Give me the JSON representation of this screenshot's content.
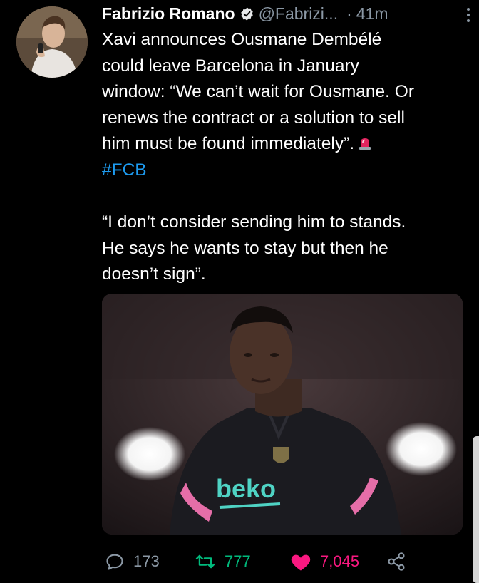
{
  "tweet": {
    "display_name": "Fabrizio Romano",
    "handle": "@Fabrizi...",
    "separator": "·",
    "time": "41m",
    "text_lines": [
      "Xavi announces Ousmane Dembélé",
      "could leave Barcelona in January",
      "window: “We can’t wait for Ousmane. Or",
      "renews the contract or a solution to sell",
      "him must be found immediately”."
    ],
    "hashtag": "#FCB",
    "quote_lines": [
      "“I don’t consider sending him to stands.",
      "He says he wants to stay but then he",
      "doesn’t sign”."
    ],
    "media_caption_logo": "beko",
    "stats": {
      "replies": "173",
      "retweets": "777",
      "likes": "7,045"
    }
  },
  "icons": {
    "verified": "verified-badge-icon",
    "more": "more-vertical-icon",
    "siren": "police-light-icon",
    "reply": "reply-icon",
    "retweet": "retweet-icon",
    "like": "heart-icon",
    "share": "share-icon"
  },
  "colors": {
    "background": "#000000",
    "text": "#ffffff",
    "secondary": "#8b98a5",
    "link": "#1d9bf0",
    "retweet": "#00ba7c",
    "like": "#f91880"
  }
}
